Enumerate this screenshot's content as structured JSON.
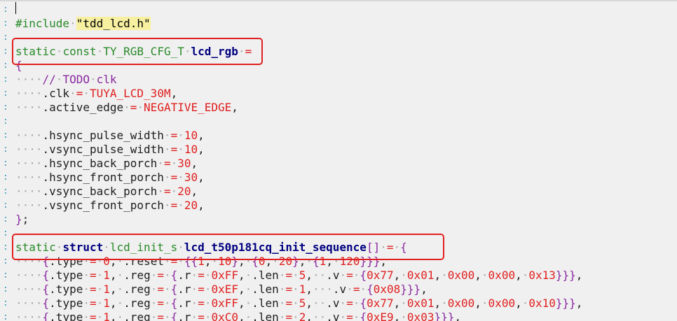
{
  "editor": {
    "gutter_marker": ":",
    "lines": [
      {
        "row": 1,
        "tokens": [
          [
            "ppd",
            "#include"
          ],
          [
            "ws",
            "·"
          ],
          [
            "str",
            "\"tdd_lcd.h\""
          ]
        ]
      },
      {
        "row": 2,
        "tokens": []
      },
      {
        "row": 3,
        "tokens": [
          [
            "kw",
            "static"
          ],
          [
            "ws",
            "·"
          ],
          [
            "kw",
            "const"
          ],
          [
            "ws",
            "·"
          ],
          [
            "type",
            "TY_RGB_CFG_T"
          ],
          [
            "ws",
            "·"
          ],
          [
            "bold",
            "lcd_rgb"
          ],
          [
            "ws",
            "·"
          ],
          [
            "op",
            "="
          ]
        ]
      },
      {
        "row": 4,
        "tokens": [
          [
            "brk",
            "{"
          ]
        ]
      },
      {
        "row": 5,
        "tokens": [
          [
            "ws",
            "····"
          ],
          [
            "cmt",
            "//"
          ],
          [
            "ws",
            "·"
          ],
          [
            "cmt",
            "TODO"
          ],
          [
            "ws",
            "·"
          ],
          [
            "cmt",
            "clk"
          ]
        ]
      },
      {
        "row": 6,
        "tokens": [
          [
            "ws",
            "····"
          ],
          [
            "fld",
            ".clk"
          ],
          [
            "ws",
            "·"
          ],
          [
            "op",
            "="
          ],
          [
            "ws",
            "·"
          ],
          [
            "mac",
            "TUYA_LCD_30M"
          ],
          [
            "pun",
            ","
          ]
        ]
      },
      {
        "row": 7,
        "tokens": [
          [
            "ws",
            "····"
          ],
          [
            "fld",
            ".active_edge"
          ],
          [
            "ws",
            "·"
          ],
          [
            "op",
            "="
          ],
          [
            "ws",
            "·"
          ],
          [
            "mac",
            "NEGATIVE_EDGE"
          ],
          [
            "pun",
            ","
          ]
        ]
      },
      {
        "row": 8,
        "tokens": []
      },
      {
        "row": 9,
        "tokens": [
          [
            "ws",
            "····"
          ],
          [
            "fld",
            ".hsync_pulse_width"
          ],
          [
            "ws",
            "·"
          ],
          [
            "op",
            "="
          ],
          [
            "ws",
            "·"
          ],
          [
            "num",
            "10"
          ],
          [
            "pun",
            ","
          ]
        ]
      },
      {
        "row": 10,
        "tokens": [
          [
            "ws",
            "····"
          ],
          [
            "fld",
            ".vsync_pulse_width"
          ],
          [
            "ws",
            "·"
          ],
          [
            "op",
            "="
          ],
          [
            "ws",
            "·"
          ],
          [
            "num",
            "10"
          ],
          [
            "pun",
            ","
          ]
        ]
      },
      {
        "row": 11,
        "tokens": [
          [
            "ws",
            "····"
          ],
          [
            "fld",
            ".hsync_back_porch"
          ],
          [
            "ws",
            "·"
          ],
          [
            "op",
            "="
          ],
          [
            "ws",
            "·"
          ],
          [
            "num",
            "30"
          ],
          [
            "pun",
            ","
          ]
        ]
      },
      {
        "row": 12,
        "tokens": [
          [
            "ws",
            "····"
          ],
          [
            "fld",
            ".hsync_front_porch"
          ],
          [
            "ws",
            "·"
          ],
          [
            "op",
            "="
          ],
          [
            "ws",
            "·"
          ],
          [
            "num",
            "30"
          ],
          [
            "pun",
            ","
          ]
        ]
      },
      {
        "row": 13,
        "tokens": [
          [
            "ws",
            "····"
          ],
          [
            "fld",
            ".vsync_back_porch"
          ],
          [
            "ws",
            "·"
          ],
          [
            "op",
            "="
          ],
          [
            "ws",
            "·"
          ],
          [
            "num",
            "20"
          ],
          [
            "pun",
            ","
          ]
        ]
      },
      {
        "row": 14,
        "tokens": [
          [
            "ws",
            "····"
          ],
          [
            "fld",
            ".vsync_front_porch"
          ],
          [
            "ws",
            "·"
          ],
          [
            "op",
            "="
          ],
          [
            "ws",
            "·"
          ],
          [
            "num",
            "20"
          ],
          [
            "pun",
            ","
          ]
        ]
      },
      {
        "row": 15,
        "tokens": [
          [
            "brk",
            "}"
          ],
          [
            "pun",
            ";"
          ]
        ]
      },
      {
        "row": 16,
        "tokens": []
      },
      {
        "row": 17,
        "tokens": [
          [
            "kw",
            "static"
          ],
          [
            "ws",
            "·"
          ],
          [
            "bold",
            "struct"
          ],
          [
            "ws",
            "·"
          ],
          [
            "type",
            "lcd_init_s"
          ],
          [
            "ws",
            "·"
          ],
          [
            "bold",
            "lcd_t50p181cq_init_sequence"
          ],
          [
            "brk",
            "[]"
          ],
          [
            "ws",
            "·"
          ],
          [
            "op",
            "="
          ],
          [
            "ws",
            "·"
          ],
          [
            "brk",
            "{"
          ]
        ]
      },
      {
        "row": 18,
        "tokens": [
          [
            "ws",
            "····"
          ],
          [
            "brk",
            "{"
          ],
          [
            "fld",
            ".type"
          ],
          [
            "ws",
            "·"
          ],
          [
            "op",
            "="
          ],
          [
            "ws",
            "·"
          ],
          [
            "num",
            "0"
          ],
          [
            "pun",
            ","
          ],
          [
            "ws",
            "·"
          ],
          [
            "fld",
            ".reset"
          ],
          [
            "ws",
            "·"
          ],
          [
            "op",
            "="
          ],
          [
            "ws",
            "·"
          ],
          [
            "brk",
            "{{"
          ],
          [
            "num",
            "1"
          ],
          [
            "pun",
            ","
          ],
          [
            "ws",
            "·"
          ],
          [
            "num",
            "10"
          ],
          [
            "brk",
            "}"
          ],
          [
            "pun",
            ","
          ],
          [
            "ws",
            "·"
          ],
          [
            "brk",
            "{"
          ],
          [
            "num",
            "0"
          ],
          [
            "pun",
            ","
          ],
          [
            "ws",
            "·"
          ],
          [
            "num",
            "20"
          ],
          [
            "brk",
            "}"
          ],
          [
            "pun",
            ","
          ],
          [
            "ws",
            "·"
          ],
          [
            "brk",
            "{"
          ],
          [
            "num",
            "1"
          ],
          [
            "pun",
            ","
          ],
          [
            "ws",
            "·"
          ],
          [
            "num",
            "120"
          ],
          [
            "brk",
            "}}}"
          ],
          [
            "pun",
            ","
          ]
        ]
      },
      {
        "row": 19,
        "tokens": [
          [
            "ws",
            "····"
          ],
          [
            "brk",
            "{"
          ],
          [
            "fld",
            ".type"
          ],
          [
            "ws",
            "·"
          ],
          [
            "op",
            "="
          ],
          [
            "ws",
            "·"
          ],
          [
            "num",
            "1"
          ],
          [
            "pun",
            ","
          ],
          [
            "ws",
            "·"
          ],
          [
            "fld",
            ".reg"
          ],
          [
            "ws",
            "·"
          ],
          [
            "op",
            "="
          ],
          [
            "ws",
            "·"
          ],
          [
            "brk",
            "{"
          ],
          [
            "fld",
            ".r"
          ],
          [
            "ws",
            "·"
          ],
          [
            "op",
            "="
          ],
          [
            "ws",
            "·"
          ],
          [
            "num",
            "0xFF"
          ],
          [
            "pun",
            ","
          ],
          [
            "ws",
            "·"
          ],
          [
            "fld",
            ".len"
          ],
          [
            "ws",
            "·"
          ],
          [
            "op",
            "="
          ],
          [
            "ws",
            "·"
          ],
          [
            "num",
            "5"
          ],
          [
            "pun",
            ","
          ],
          [
            "ws",
            "··"
          ],
          [
            "fld",
            ".v"
          ],
          [
            "ws",
            "·"
          ],
          [
            "op",
            "="
          ],
          [
            "ws",
            "·"
          ],
          [
            "brk",
            "{"
          ],
          [
            "num",
            "0x77"
          ],
          [
            "pun",
            ","
          ],
          [
            "ws",
            "·"
          ],
          [
            "num",
            "0x01"
          ],
          [
            "pun",
            ","
          ],
          [
            "ws",
            "·"
          ],
          [
            "num",
            "0x00"
          ],
          [
            "pun",
            ","
          ],
          [
            "ws",
            "·"
          ],
          [
            "num",
            "0x00"
          ],
          [
            "pun",
            ","
          ],
          [
            "ws",
            "·"
          ],
          [
            "num",
            "0x13"
          ],
          [
            "brk",
            "}}}"
          ],
          [
            "pun",
            ","
          ]
        ]
      },
      {
        "row": 20,
        "tokens": [
          [
            "ws",
            "····"
          ],
          [
            "brk",
            "{"
          ],
          [
            "fld",
            ".type"
          ],
          [
            "ws",
            "·"
          ],
          [
            "op",
            "="
          ],
          [
            "ws",
            "·"
          ],
          [
            "num",
            "1"
          ],
          [
            "pun",
            ","
          ],
          [
            "ws",
            "·"
          ],
          [
            "fld",
            ".reg"
          ],
          [
            "ws",
            "·"
          ],
          [
            "op",
            "="
          ],
          [
            "ws",
            "·"
          ],
          [
            "brk",
            "{"
          ],
          [
            "fld",
            ".r"
          ],
          [
            "ws",
            "·"
          ],
          [
            "op",
            "="
          ],
          [
            "ws",
            "·"
          ],
          [
            "num",
            "0xEF"
          ],
          [
            "pun",
            ","
          ],
          [
            "ws",
            "·"
          ],
          [
            "fld",
            ".len"
          ],
          [
            "ws",
            "·"
          ],
          [
            "op",
            "="
          ],
          [
            "ws",
            "·"
          ],
          [
            "num",
            "1"
          ],
          [
            "pun",
            ","
          ],
          [
            "ws",
            "···"
          ],
          [
            "fld",
            ".v"
          ],
          [
            "ws",
            "·"
          ],
          [
            "op",
            "="
          ],
          [
            "ws",
            "·"
          ],
          [
            "brk",
            "{"
          ],
          [
            "num",
            "0x08"
          ],
          [
            "brk",
            "}}}"
          ],
          [
            "pun",
            ","
          ]
        ]
      },
      {
        "row": 21,
        "tokens": [
          [
            "ws",
            "····"
          ],
          [
            "brk",
            "{"
          ],
          [
            "fld",
            ".type"
          ],
          [
            "ws",
            "·"
          ],
          [
            "op",
            "="
          ],
          [
            "ws",
            "·"
          ],
          [
            "num",
            "1"
          ],
          [
            "pun",
            ","
          ],
          [
            "ws",
            "·"
          ],
          [
            "fld",
            ".reg"
          ],
          [
            "ws",
            "·"
          ],
          [
            "op",
            "="
          ],
          [
            "ws",
            "·"
          ],
          [
            "brk",
            "{"
          ],
          [
            "fld",
            ".r"
          ],
          [
            "ws",
            "·"
          ],
          [
            "op",
            "="
          ],
          [
            "ws",
            "·"
          ],
          [
            "num",
            "0xFF"
          ],
          [
            "pun",
            ","
          ],
          [
            "ws",
            "·"
          ],
          [
            "fld",
            ".len"
          ],
          [
            "ws",
            "·"
          ],
          [
            "op",
            "="
          ],
          [
            "ws",
            "·"
          ],
          [
            "num",
            "5"
          ],
          [
            "pun",
            ","
          ],
          [
            "ws",
            "··"
          ],
          [
            "fld",
            ".v"
          ],
          [
            "ws",
            "·"
          ],
          [
            "op",
            "="
          ],
          [
            "ws",
            "·"
          ],
          [
            "brk",
            "{"
          ],
          [
            "num",
            "0x77"
          ],
          [
            "pun",
            ","
          ],
          [
            "ws",
            "·"
          ],
          [
            "num",
            "0x01"
          ],
          [
            "pun",
            ","
          ],
          [
            "ws",
            "·"
          ],
          [
            "num",
            "0x00"
          ],
          [
            "pun",
            ","
          ],
          [
            "ws",
            "·"
          ],
          [
            "num",
            "0x00"
          ],
          [
            "pun",
            ","
          ],
          [
            "ws",
            "·"
          ],
          [
            "num",
            "0x10"
          ],
          [
            "brk",
            "}}}"
          ],
          [
            "pun",
            ","
          ]
        ]
      },
      {
        "row": 22,
        "tokens": [
          [
            "ws",
            "····"
          ],
          [
            "brk",
            "{"
          ],
          [
            "fld",
            ".type"
          ],
          [
            "ws",
            "·"
          ],
          [
            "op",
            "="
          ],
          [
            "ws",
            "·"
          ],
          [
            "num",
            "1"
          ],
          [
            "pun",
            ","
          ],
          [
            "ws",
            "·"
          ],
          [
            "fld",
            ".reg"
          ],
          [
            "ws",
            "·"
          ],
          [
            "op",
            "="
          ],
          [
            "ws",
            "·"
          ],
          [
            "brk",
            "{"
          ],
          [
            "fld",
            ".r"
          ],
          [
            "ws",
            "·"
          ],
          [
            "op",
            "="
          ],
          [
            "ws",
            "·"
          ],
          [
            "num",
            "0xC0"
          ],
          [
            "pun",
            ","
          ],
          [
            "ws",
            "·"
          ],
          [
            "fld",
            ".len"
          ],
          [
            "ws",
            "·"
          ],
          [
            "op",
            "="
          ],
          [
            "ws",
            "·"
          ],
          [
            "num",
            "2"
          ],
          [
            "pun",
            ","
          ],
          [
            "ws",
            "··"
          ],
          [
            "fld",
            ".v"
          ],
          [
            "ws",
            "·"
          ],
          [
            "op",
            "="
          ],
          [
            "ws",
            "·"
          ],
          [
            "brk",
            "{"
          ],
          [
            "num",
            "0xE9"
          ],
          [
            "pun",
            ","
          ],
          [
            "ws",
            "·"
          ],
          [
            "num",
            "0x03"
          ],
          [
            "brk",
            "}}}"
          ],
          [
            "pun",
            ","
          ]
        ]
      }
    ],
    "highlight_color": "#e02020"
  }
}
